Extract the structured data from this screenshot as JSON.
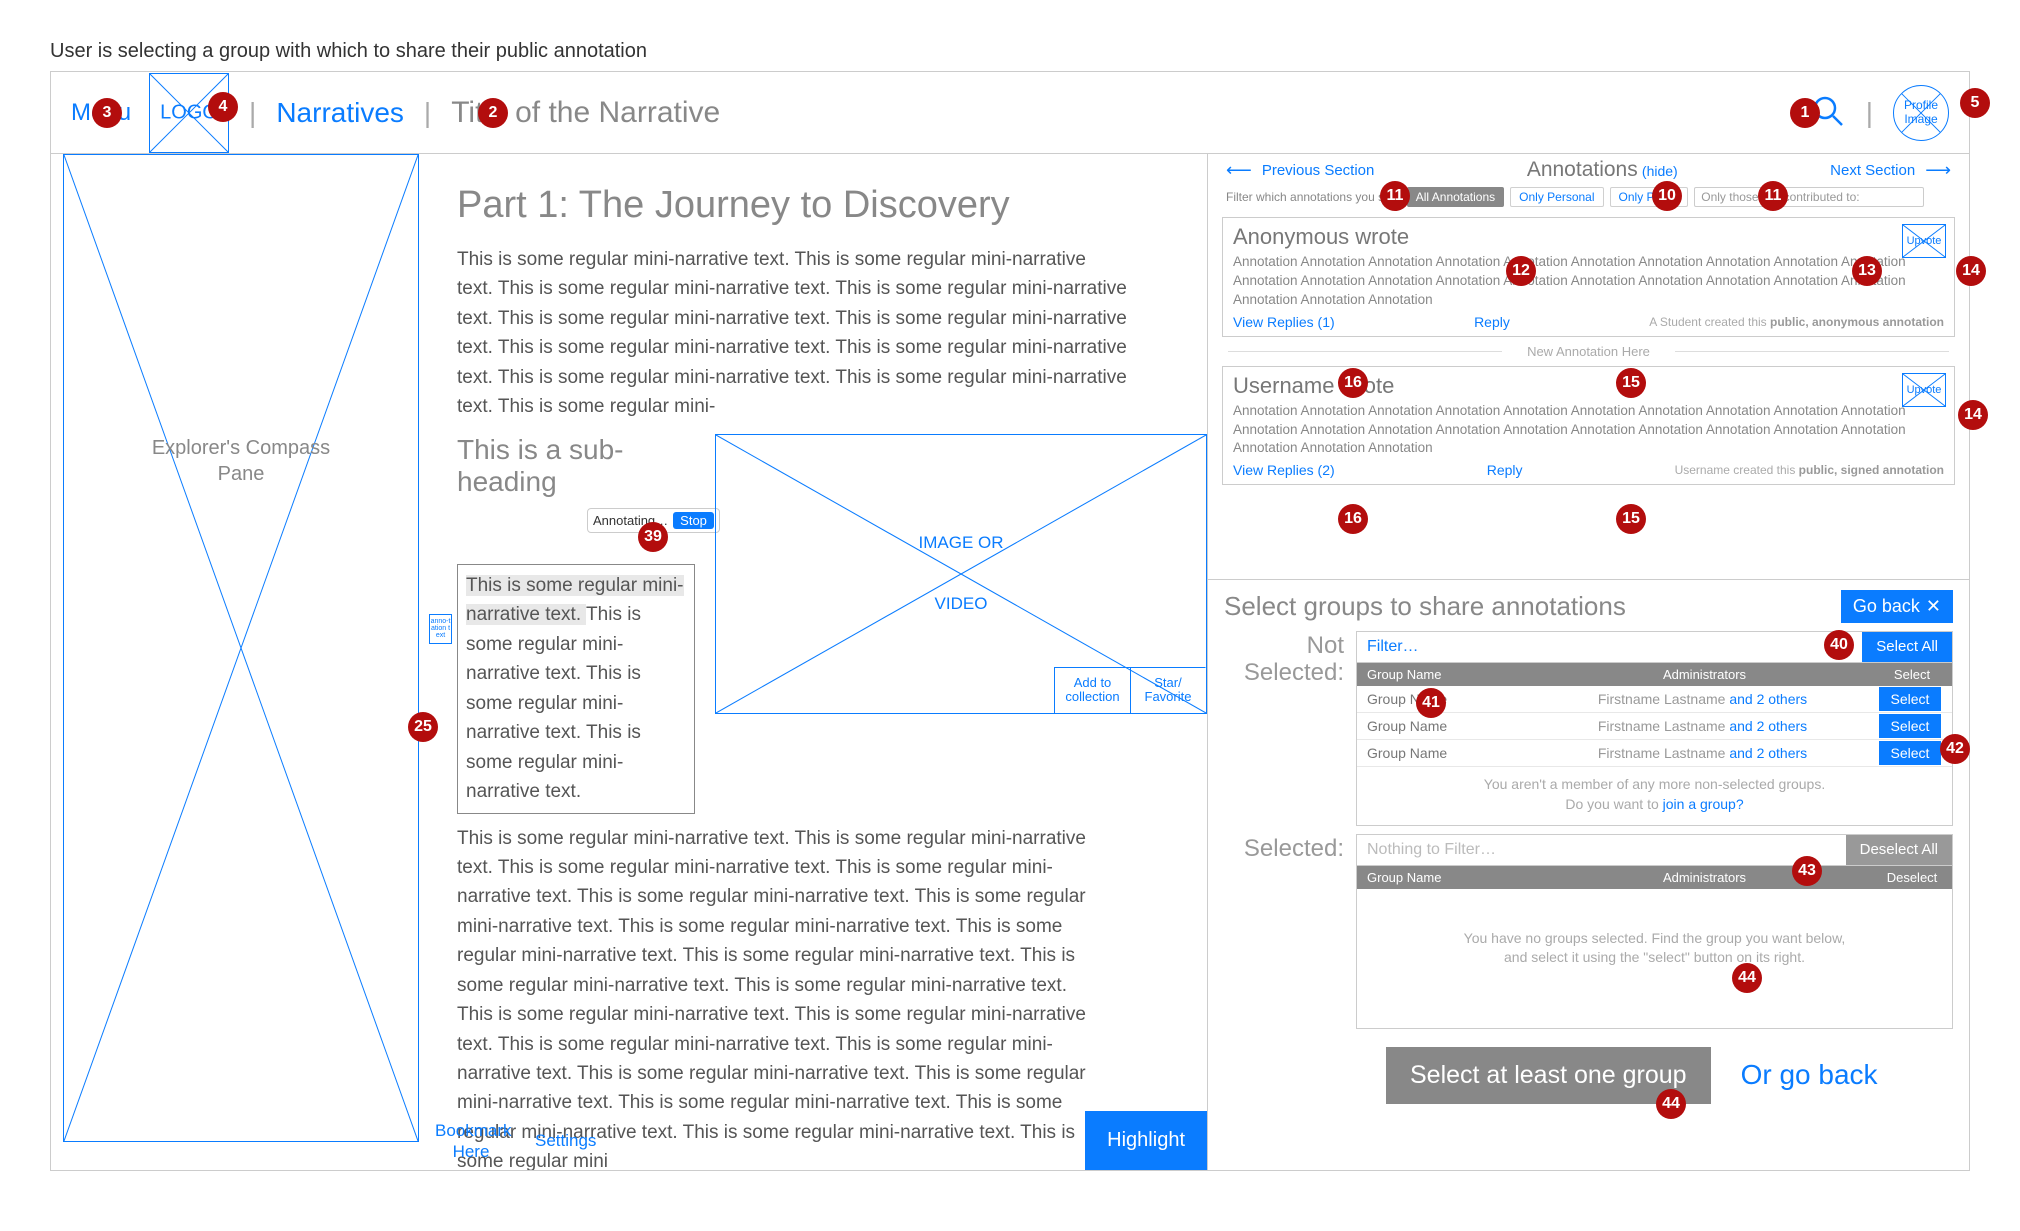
{
  "caption": "User is selecting a group with which to share their public annotation",
  "header": {
    "menu": "Menu",
    "logo": "LOGO",
    "narratives": "Narratives",
    "title": "Title of the Narrative",
    "profile": "Profile Image"
  },
  "left": {
    "explorer_l1": "Explorer's Compass",
    "explorer_l2": "Pane"
  },
  "middle": {
    "h1": "Part 1: The Journey to Discovery",
    "para1": "This is some regular mini-narrative text. This is some regular mini-narrative text. This is some regular mini-narrative text. This is some regular mini-narrative text. This is some regular mini-narrative text. This is some regular mini-narrative text. This is some regular mini-narrative text. This is some regular mini-narrative text. This is some regular mini-narrative text. This is some regular mini-narrative text. This is some regular mini-",
    "sub_l1": "This is a sub-",
    "sub_l2": "heading",
    "annotating": "Annotating…",
    "stop": "Stop",
    "hl_text": "This is some regular mini-narrative text. ",
    "box_rest": "This is some regular mini-narrative text. This is some regular mini-narrative text. This is some regular mini-narrative text.",
    "margin_tag": "anno-tation text",
    "media_l1": "IMAGE OR",
    "media_l2": "VIDEO",
    "add_collection": "Add to collection",
    "star_favorite": "Star/ Favorite",
    "para2": "This is some regular mini-narrative text. This is some regular mini-narrative text. This is some regular mini-narrative text. This is some regular mini-narrative text. This is some regular mini-narrative text. This is some regular mini-narrative text. This is some regular mini-narrative text. This is some regular mini-narrative text. This is some regular mini-narrative text. This is some regular mini-narrative text. This is some regular mini-narrative text. This is some regular mini-narrative text. This is some regular mini-narrative text. This is some regular mini-narrative text. This is some regular mini-narrative text. This is some regular mini-narrative text. This is some regular mini-narrative text. This is some regular mini-narrative text. This is some regular mini-narrative text. This is some regular mini-narrative text. This is some regular mini",
    "bookmark": "Bookmark Here",
    "settings": "Settings",
    "highlight": "Highlight"
  },
  "right": {
    "prev": "Previous Section",
    "title": "Annotations",
    "hide": "(hide)",
    "next": "Next Section",
    "filter_label": "Filter which annotations you see:",
    "f_all": "All Annotations",
    "f_personal": "Only Personal",
    "f_public": "Only Public",
    "f_contrib": "Only those I've contributed to:",
    "upvote": "Upvote",
    "a1_head": "Anonymous wrote",
    "a_body": "Annotation Annotation Annotation Annotation Annotation Annotation Annotation Annotation Annotation Annotation Annotation Annotation Annotation Annotation Annotation Annotation Annotation Annotation Annotation Annotation Annotation Annotation Annotation",
    "a1_replies": "View Replies (1)",
    "reply": "Reply",
    "a1_attr_pre": "A Student created this ",
    "a1_attr_b": "public, anonymous annotation",
    "new_anno": "New Annotation Here",
    "a2_head": "Username wrote",
    "a2_replies": "View Replies (2)",
    "a2_attr_pre": "Username created this ",
    "a2_attr_b": "public, signed annotation"
  },
  "share": {
    "title": "Select groups to share annotations",
    "goback": "Go back",
    "not_selected": "Not Selected:",
    "selected": "Selected:",
    "filter_ph": "Filter…",
    "select_all": "Select All",
    "deselect_all": "Deselect All",
    "th_group": "Group Name",
    "th_admin": "Administrators",
    "th_select": "Select",
    "th_deselect": "Deselect",
    "group_name": "Group Name",
    "admin_name": "Firstname Lastname",
    "and_others": " and 2 others",
    "select_btn": "Select",
    "no_more_l1": "You aren't a member of any more non-selected groups.",
    "no_more_l2a": "Do you want to ",
    "no_more_link": "join a group?",
    "nothing": "Nothing to Filter…",
    "empty_l1": "You have no groups selected. Find the group you want below,",
    "empty_l2": "and select it using the \"select\" button on its right.",
    "bottom_btn": "Select at least one group",
    "bottom_link": "Or go back"
  },
  "badges": {
    "b1": "1",
    "b2": "2",
    "b3": "3",
    "b4": "4",
    "b5": "5",
    "b10": "10",
    "b11a": "11",
    "b11b": "11",
    "b12": "12",
    "b13": "13",
    "b14a": "14",
    "b14b": "14",
    "b15a": "15",
    "b15b": "15",
    "b16a": "16",
    "b16b": "16",
    "b25": "25",
    "b39": "39",
    "b40": "40",
    "b41": "41",
    "b42": "42",
    "b43": "43",
    "b44a": "44",
    "b44b": "44"
  }
}
